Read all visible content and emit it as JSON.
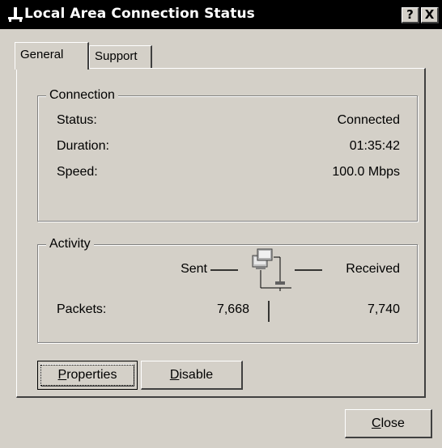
{
  "window": {
    "title": "Local Area Connection Status",
    "help_button": "?",
    "close_button": "X",
    "title_icon": "network-connection-icon"
  },
  "tabs": [
    {
      "label": "General",
      "selected": true
    },
    {
      "label": "Support",
      "selected": false
    }
  ],
  "connection": {
    "title": "Connection",
    "rows": [
      {
        "label": "Status:",
        "value": "Connected"
      },
      {
        "label": "Duration:",
        "value": "01:35:42"
      },
      {
        "label": "Speed:",
        "value": "100.0 Mbps"
      }
    ]
  },
  "activity": {
    "title": "Activity",
    "sent_label": "Sent",
    "received_label": "Received",
    "packets_label": "Packets:",
    "packets_sent": "7,668",
    "packets_received": "7,740",
    "icon": "network-computers-icon"
  },
  "buttons": {
    "properties": {
      "mnemonic": "P",
      "rest": "roperties"
    },
    "disable": {
      "mnemonic": "D",
      "rest": "isable"
    },
    "close": {
      "mnemonic": "C",
      "rest": "lose"
    }
  },
  "colors": {
    "face": "#d4d0c8",
    "titlebar": "#000000",
    "shadow": "#404040",
    "highlight": "#ffffff"
  }
}
